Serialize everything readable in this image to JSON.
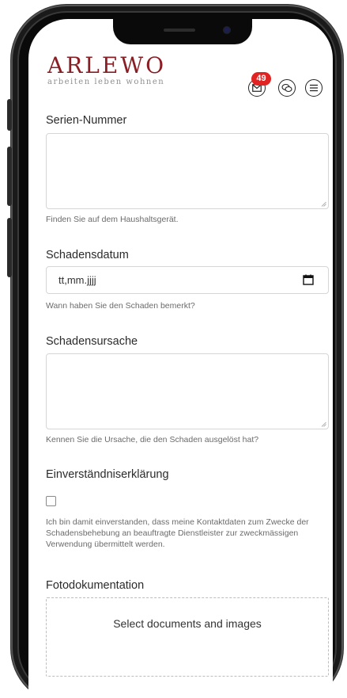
{
  "header": {
    "logo_text": "ARLEWO",
    "logo_tagline": "arbeiten leben wohnen",
    "notification_count": "49",
    "icons": [
      "mail-icon",
      "chat-icon",
      "menu-icon"
    ]
  },
  "form": {
    "serial": {
      "label": "Serien-Nummer",
      "value": "",
      "help": "Finden Sie auf dem Haushaltsgerät."
    },
    "damage_date": {
      "label": "Schadensdatum",
      "placeholder": "tt,mm.jjjj",
      "help": "Wann haben Sie den Schaden bemerkt?"
    },
    "damage_cause": {
      "label": "Schadensursache",
      "value": "",
      "help": "Kennen Sie die Ursache, die den Schaden ausgelöst hat?"
    },
    "consent": {
      "label": "Einverständniserklärung",
      "checked": false,
      "text": "Ich bin damit einverstanden, dass meine Kontaktdaten zum Zwecke der Schadensbehebung an beauftragte Dienstleister zur zweckmässigen Verwendung übermittelt werden."
    },
    "photos": {
      "label": "Fotodokumentation",
      "dropzone_text": "Select documents and images"
    }
  },
  "colors": {
    "brand": "#8a1e25",
    "badge": "#e02323",
    "text": "#2b2b2b",
    "help_text": "#6b6b6b",
    "border": "#d6d6d6"
  }
}
